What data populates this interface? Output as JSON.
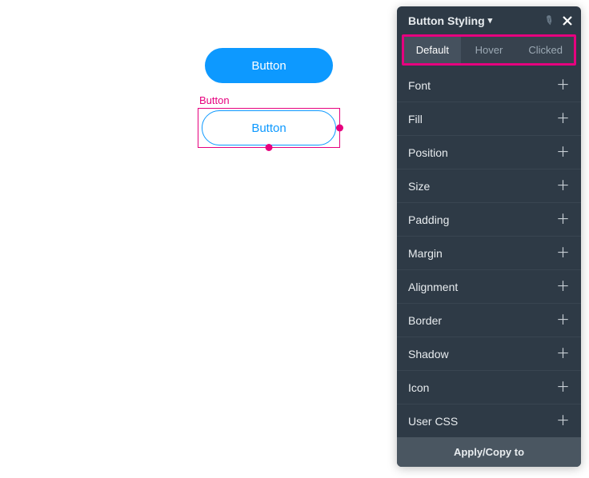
{
  "canvas": {
    "primary_button_label": "Button",
    "selected_element_label": "Button",
    "outline_button_label": "Button"
  },
  "panel": {
    "title": "Button Styling",
    "tabs": {
      "default": "Default",
      "hover": "Hover",
      "clicked": "Clicked"
    },
    "sections": {
      "font": "Font",
      "fill": "Fill",
      "position": "Position",
      "size": "Size",
      "padding": "Padding",
      "margin": "Margin",
      "alignment": "Alignment",
      "border": "Border",
      "shadow": "Shadow",
      "icon": "Icon",
      "user_css": "User CSS"
    },
    "apply_label": "Apply/Copy to"
  }
}
